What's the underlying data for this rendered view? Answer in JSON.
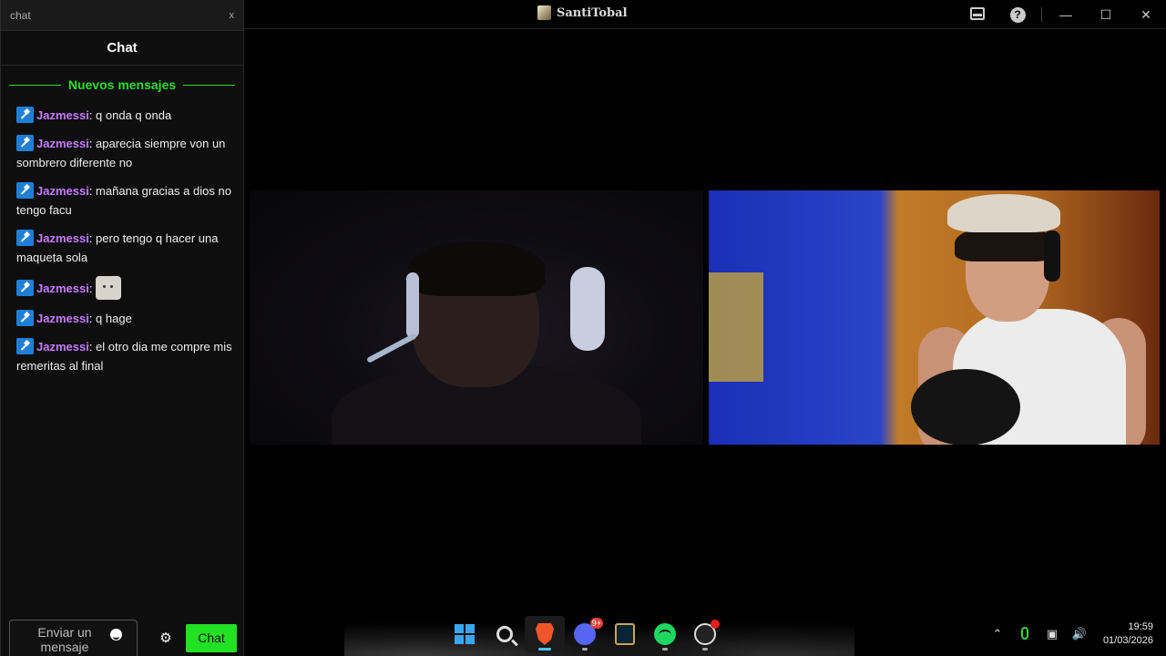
{
  "chat_window": {
    "title": "chat",
    "close_label": "x",
    "header": "Chat",
    "new_messages_label": "Nuevos mensajes",
    "messages": [
      {
        "user": "Jazmessi",
        "text": ": q onda q onda"
      },
      {
        "user": "Jazmessi",
        "text": ": aparecia siempre von un sombrero diferente no"
      },
      {
        "user": "Jazmessi",
        "text": ": mañana gracias a dios no tengo facu"
      },
      {
        "user": "Jazmessi",
        "text": ": pero tengo q hacer una maqueta sola"
      },
      {
        "user": "Jazmessi",
        "text": ":"
      },
      {
        "user": "Jazmessi",
        "text": ": q hage"
      },
      {
        "user": "Jazmessi",
        "text": ": el otro dia me compre mis remeritas al final"
      }
    ],
    "input_placeholder": "Enviar un mensaje",
    "send_label": "Chat"
  },
  "main_window": {
    "title": "SantiTobal"
  },
  "taskbar": {
    "discord_badge": "9+",
    "time": "19:59",
    "date": "01/03/2026"
  },
  "colors": {
    "accent_green": "#22e022",
    "username": "#c87bff",
    "background": "#000000"
  }
}
